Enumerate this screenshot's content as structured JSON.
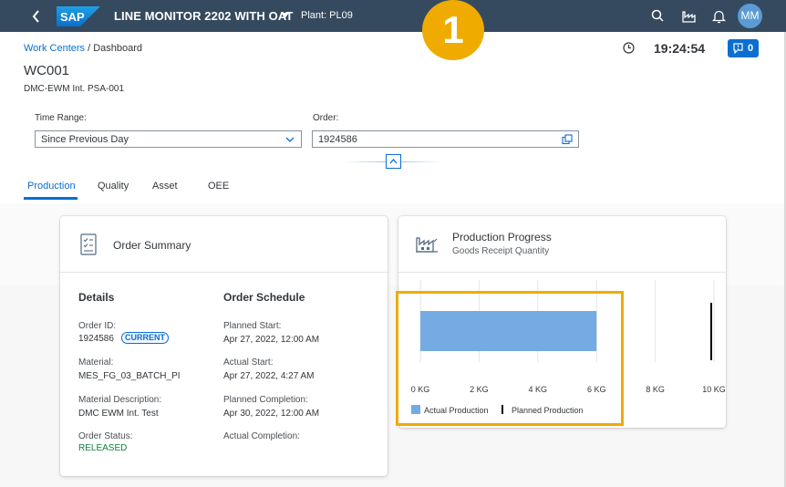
{
  "shell": {
    "logo_text": "SAP",
    "title": "LINE MONITOR 2202 WITH OAT",
    "plant": "Plant: PL09",
    "avatar_initials": "MM",
    "icons": [
      "back-icon",
      "search-icon",
      "factory-icon",
      "bell-icon"
    ]
  },
  "step_badge": "1",
  "breadcrumb": {
    "link": "Work Centers",
    "separator": " / ",
    "current": "Dashboard"
  },
  "time": "19:24:54",
  "notifications": {
    "count": "0"
  },
  "work_center": {
    "id": "WC001",
    "description": "DMC-EWM Int. PSA-001"
  },
  "filters": {
    "time_range": {
      "label": "Time Range:",
      "value": "Since Previous Day"
    },
    "order": {
      "label": "Order:",
      "value": "1924586"
    }
  },
  "tabs": [
    {
      "label": "Production",
      "active": true
    },
    {
      "label": "Quality",
      "active": false
    },
    {
      "label": "Asset",
      "active": false
    },
    {
      "label": "OEE",
      "active": false
    }
  ],
  "order_summary": {
    "title": "Order Summary",
    "details_title": "Details",
    "schedule_title": "Order Schedule",
    "details": {
      "order_id_label": "Order ID:",
      "order_id": "1924586",
      "order_badge": "CURRENT",
      "material_label": "Material:",
      "material": "MES_FG_03_BATCH_PI",
      "material_desc_label": "Material Description:",
      "material_desc": "DMC EWM Int. Test",
      "status_label": "Order Status:",
      "status": "RELEASED"
    },
    "schedule": {
      "planned_start_label": "Planned Start:",
      "planned_start": "Apr 27, 2022, 12:00 AM",
      "actual_start_label": "Actual Start:",
      "actual_start": "Apr 27, 2022, 4:27 AM",
      "planned_completion_label": "Planned Completion:",
      "planned_completion": "Apr 30, 2022, 12:00 AM",
      "actual_completion_label": "Actual Completion:"
    }
  },
  "production_progress": {
    "title": "Production Progress",
    "subtitle": "Goods Receipt Quantity"
  },
  "chart_data": {
    "type": "bar",
    "orientation": "horizontal",
    "unit": "KG",
    "xlim": [
      0,
      10
    ],
    "ticks": [
      0,
      2,
      4,
      6,
      8,
      10
    ],
    "tick_labels": [
      "0 KG",
      "2 KG",
      "4 KG",
      "6 KG",
      "8 KG",
      "10 KG"
    ],
    "series": [
      {
        "name": "Actual Production",
        "values": [
          6
        ],
        "color": "#74abe2",
        "mark": "bar"
      },
      {
        "name": "Planned Production",
        "values": [
          10
        ],
        "color": "#000000",
        "mark": "target-line"
      }
    ],
    "grid": true,
    "legend": "bottom-left"
  },
  "colors": {
    "shell": "#354a5f",
    "accent": "#0a6ed1",
    "highlight": "#f0ab00",
    "status_green": "#107e3e"
  }
}
